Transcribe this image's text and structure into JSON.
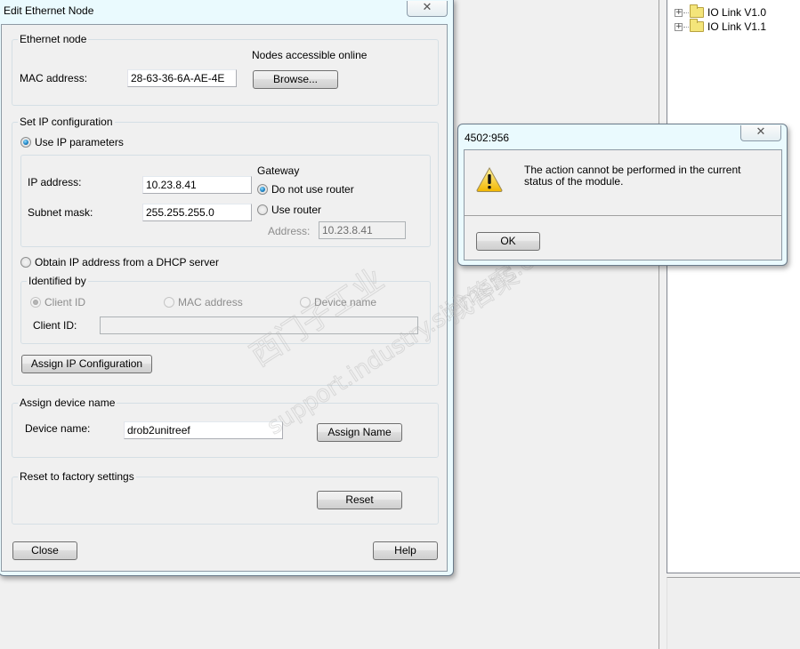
{
  "background": {
    "tree": {
      "items": [
        {
          "label": "IO Link V1.0",
          "expander": "+",
          "icon": "folder-icon"
        },
        {
          "label": "IO Link V1.1",
          "expander": "+",
          "icon": "folder-icon"
        }
      ]
    },
    "watermark": {
      "line1": "西门子工业",
      "line2": "support.industry.siemens.com/cs",
      "line3": "找答案"
    }
  },
  "edit_dialog": {
    "title": "Edit Ethernet Node",
    "close_glyph": "✕",
    "ethernet_node": {
      "group_label": "Ethernet node",
      "mac_label": "MAC address:",
      "mac_value": "28-63-36-6A-AE-4E",
      "nodes_online_label": "Nodes accessible online",
      "browse_button": "Browse..."
    },
    "ip_config": {
      "group_label": "Set IP configuration",
      "use_ip_params_label": "Use IP parameters",
      "use_ip_params_checked": true,
      "ip_label": "IP address:",
      "ip_value": "10.23.8.41",
      "subnet_label": "Subnet mask:",
      "subnet_value": "255.255.255.0",
      "gateway_label": "Gateway",
      "no_router_label": "Do not use router",
      "no_router_checked": true,
      "use_router_label": "Use router",
      "use_router_checked": false,
      "router_address_label": "Address:",
      "router_address_value": "10.23.8.41",
      "dhcp_label": "Obtain IP address from a DHCP server",
      "dhcp_checked": false,
      "identified_by_label": "Identified by",
      "client_id_radio": "Client ID",
      "mac_radio": "MAC address",
      "device_name_radio": "Device name",
      "client_id_field_label": "Client ID:",
      "client_id_value": "",
      "assign_ip_button": "Assign IP Configuration"
    },
    "device_name": {
      "group_label": "Assign device name",
      "label": "Device name:",
      "value": "drob2unitreef",
      "assign_button": "Assign Name"
    },
    "reset": {
      "group_label": "Reset to factory settings",
      "reset_button": "Reset"
    },
    "close_button": "Close",
    "help_button": "Help"
  },
  "message_dialog": {
    "title": "4502:956",
    "close_glyph": "✕",
    "icon": "warning-icon",
    "message": "The action cannot be performed in the current status of the module.",
    "ok_button": "OK"
  }
}
